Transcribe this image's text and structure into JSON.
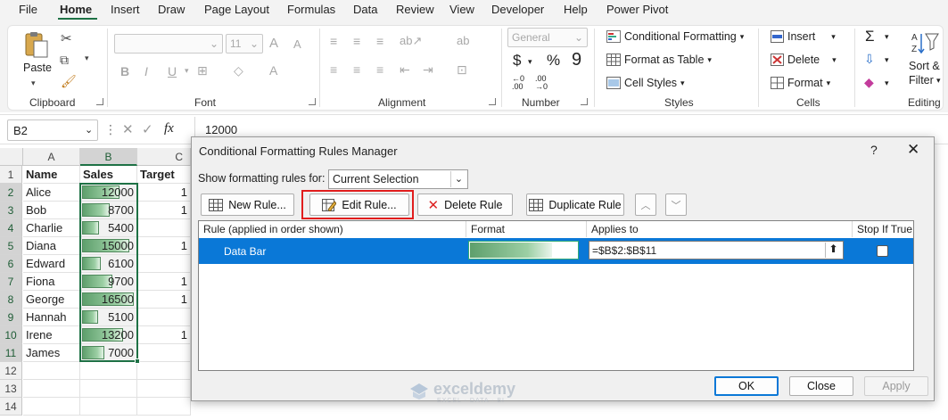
{
  "menu": {
    "tabs": [
      "File",
      "Home",
      "Insert",
      "Draw",
      "Page Layout",
      "Formulas",
      "Data",
      "Review",
      "View",
      "Developer",
      "Help",
      "Power Pivot"
    ],
    "active": "Home"
  },
  "ribbon": {
    "clipboard": {
      "paste": "Paste",
      "label": "Clipboard"
    },
    "font": {
      "name_value": "",
      "size_value": "11",
      "label": "Font",
      "bold": "B",
      "italic": "I",
      "underline": "U",
      "grow": "A",
      "shrink": "A"
    },
    "alignment": {
      "label": "Alignment"
    },
    "number": {
      "format_value": "General",
      "label": "Number",
      "currency": "$",
      "percent": "%",
      "comma": "9"
    },
    "styles": {
      "conditional": "Conditional Formatting",
      "table": "Format as Table",
      "cell_styles": "Cell Styles",
      "label": "Styles"
    },
    "cells": {
      "insert": "Insert",
      "delete": "Delete",
      "format": "Format",
      "label": "Cells"
    },
    "editing": {
      "sort": "Sort &",
      "filter": "Filter",
      "label": "Editing"
    }
  },
  "formula_bar": {
    "name_box": "B2",
    "fx": "fx",
    "value": "12000"
  },
  "sheet": {
    "columns": [
      "A",
      "B",
      "C"
    ],
    "rows": [
      "1",
      "2",
      "3",
      "4",
      "5",
      "6",
      "7",
      "8",
      "9",
      "10",
      "11",
      "12",
      "13",
      "14"
    ],
    "headers": {
      "name": "Name",
      "sales": "Sales",
      "target": "Target"
    },
    "data": [
      {
        "name": "Alice",
        "sales": "12000",
        "value": 12000,
        "target": "1"
      },
      {
        "name": "Bob",
        "sales": "8700",
        "value": 8700,
        "target": "1"
      },
      {
        "name": "Charlie",
        "sales": "5400",
        "value": 5400,
        "target": ""
      },
      {
        "name": "Diana",
        "sales": "15000",
        "value": 15000,
        "target": "1"
      },
      {
        "name": "Edward",
        "sales": "6100",
        "value": 6100,
        "target": ""
      },
      {
        "name": "Fiona",
        "sales": "9700",
        "value": 9700,
        "target": "1"
      },
      {
        "name": "George",
        "sales": "16500",
        "value": 16500,
        "target": "1"
      },
      {
        "name": "Hannah",
        "sales": "5100",
        "value": 5100,
        "target": ""
      },
      {
        "name": "Irene",
        "sales": "13200",
        "value": 13200,
        "target": "1"
      },
      {
        "name": "James",
        "sales": "7000",
        "value": 7000,
        "target": ""
      }
    ]
  },
  "dialog": {
    "title": "Conditional Formatting Rules Manager",
    "help": "?",
    "show_label": "Show formatting rules for:",
    "show_value": "Current Selection",
    "buttons": {
      "new": "New Rule...",
      "edit": "Edit Rule...",
      "delete": "Delete Rule",
      "duplicate": "Duplicate Rule"
    },
    "columns": {
      "rule": "Rule (applied in order shown)",
      "format": "Format",
      "applies": "Applies to",
      "stop": "Stop If True"
    },
    "rule": {
      "name": "Data Bar",
      "applies_to": "=$B$2:$B$11"
    },
    "footer": {
      "ok": "OK",
      "close": "Close",
      "apply": "Apply"
    }
  },
  "watermark": {
    "name": "exceldemy",
    "tagline": "EXCEL · DATA · BI"
  },
  "colors": {
    "accent_green": "#1e7145",
    "selection_blue": "#0a78d7",
    "highlight_red": "#e11d1d"
  }
}
